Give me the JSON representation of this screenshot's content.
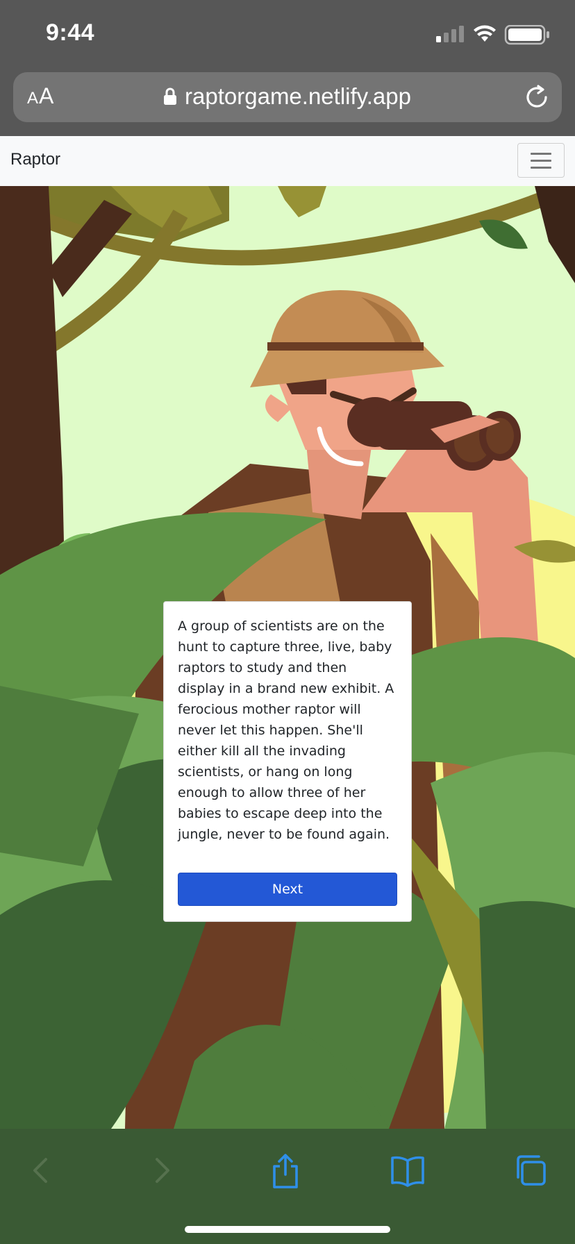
{
  "status_bar": {
    "time": "9:44"
  },
  "url_bar": {
    "text_size_label_small": "A",
    "text_size_label_large": "A",
    "url": "raptorgame.netlify.app"
  },
  "navbar": {
    "brand": "Raptor"
  },
  "dialog": {
    "story": "A group of scientists are on the hunt to capture three, live, baby raptors to study and then display in a brand new exhibit. A ferocious mother raptor will never let this happen. She'll either kill all the invading scientists, or hang on long enough to allow three of her babies to escape deep into the jungle, never to be found again.",
    "next_label": "Next"
  },
  "toolbar": {
    "icons": [
      "back-icon",
      "forward-icon",
      "share-icon",
      "bookmarks-icon",
      "tabs-icon"
    ]
  },
  "colors": {
    "chrome": "#575757",
    "accent_button": "#2358d6",
    "toolbar": "#3a5a34"
  }
}
